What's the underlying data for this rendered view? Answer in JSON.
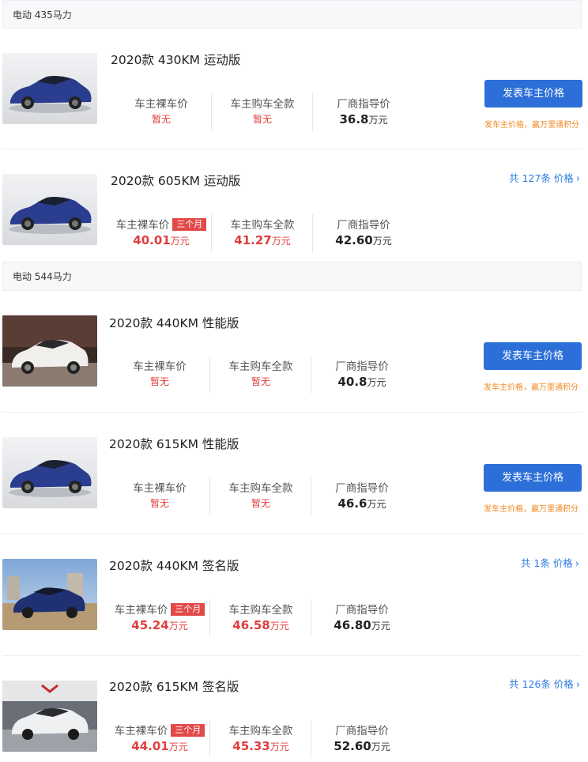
{
  "groups": [
    {
      "header": "电动 435马力",
      "items": [
        {
          "title": "2020款 430KM 运动版",
          "owner_bare_label": "车主裸车价",
          "owner_bare_value": "暂无",
          "owner_full_label": "车主购车全款",
          "owner_full_value": "暂无",
          "guide_label": "厂商指导价",
          "guide_value": "36.8",
          "guide_unit": "万元",
          "post_button": "发表车主价格",
          "post_note": "发车主价格，赢万里通积分"
        },
        {
          "title": "2020款 605KM 运动版",
          "owner_bare_label": "车主裸车价",
          "badge": "三个月",
          "owner_bare_value": "40.01",
          "owner_bare_unit": "万元",
          "owner_full_label": "车主购车全款",
          "owner_full_value": "41.27",
          "owner_full_unit": "万元",
          "guide_label": "厂商指导价",
          "guide_value": "42.60",
          "guide_unit": "万元",
          "count_link": "共 127条 价格"
        }
      ]
    },
    {
      "header": "电动 544马力",
      "items": [
        {
          "title": "2020款 440KM 性能版",
          "owner_bare_label": "车主裸车价",
          "owner_bare_value": "暂无",
          "owner_full_label": "车主购车全款",
          "owner_full_value": "暂无",
          "guide_label": "厂商指导价",
          "guide_value": "40.8",
          "guide_unit": "万元",
          "post_button": "发表车主价格",
          "post_note": "发车主价格，赢万里通积分"
        },
        {
          "title": "2020款 615KM 性能版",
          "owner_bare_label": "车主裸车价",
          "owner_bare_value": "暂无",
          "owner_full_label": "车主购车全款",
          "owner_full_value": "暂无",
          "guide_label": "厂商指导价",
          "guide_value": "46.6",
          "guide_unit": "万元",
          "post_button": "发表车主价格",
          "post_note": "发车主价格，赢万里通积分"
        },
        {
          "title": "2020款 440KM 签名版",
          "owner_bare_label": "车主裸车价",
          "badge": "三个月",
          "owner_bare_value": "45.24",
          "owner_bare_unit": "万元",
          "owner_full_label": "车主购车全款",
          "owner_full_value": "46.58",
          "owner_full_unit": "万元",
          "guide_label": "厂商指导价",
          "guide_value": "46.80",
          "guide_unit": "万元",
          "count_link": "共 1条 价格"
        },
        {
          "title": "2020款 615KM 签名版",
          "owner_bare_label": "车主裸车价",
          "badge": "三个月",
          "owner_bare_value": "44.01",
          "owner_bare_unit": "万元",
          "owner_full_label": "车主购车全款",
          "owner_full_value": "45.33",
          "owner_full_unit": "万元",
          "guide_label": "厂商指导价",
          "guide_value": "52.60",
          "guide_unit": "万元",
          "count_link": "共 126条 价格"
        }
      ]
    }
  ]
}
